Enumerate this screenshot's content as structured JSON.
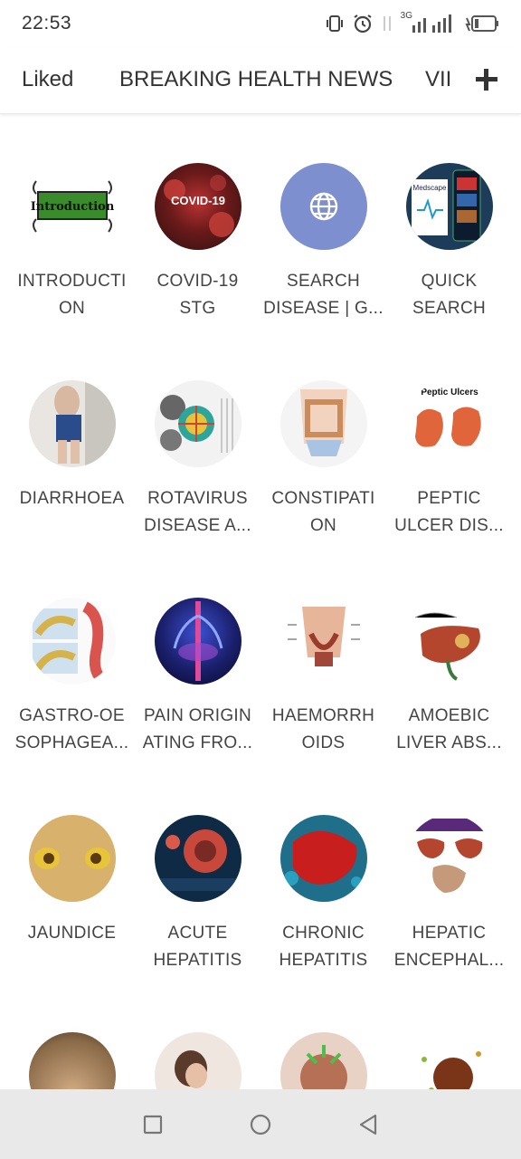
{
  "status": {
    "time": "22:53",
    "network": "3G"
  },
  "tabs": [
    {
      "label": "Liked"
    },
    {
      "label": "BREAKING HEALTH NEWS"
    },
    {
      "label": "VII"
    }
  ],
  "tiles": [
    {
      "label": "INTRODUCTI\nON",
      "image_text": "Introduction"
    },
    {
      "label": "COVID-19\nSTG",
      "image_text": "COVID-19"
    },
    {
      "label": "SEARCH\nDISEASE | G...",
      "icon": "globe-icon"
    },
    {
      "label": "QUICK\nSEARCH",
      "image_text": "Medscape"
    },
    {
      "label": "DIARRHOEA"
    },
    {
      "label": "ROTAVIRUS\nDISEASE A..."
    },
    {
      "label": "CONSTIPATI\nON"
    },
    {
      "label": "PEPTIC\nULCER DIS...",
      "image_text": "Peptic Ulcers"
    },
    {
      "label": "GASTRO-OE\nSOPHAGEA..."
    },
    {
      "label": "PAIN ORIGIN\nATING FRO..."
    },
    {
      "label": "HAEMORRH\nOIDS"
    },
    {
      "label": "AMOEBIC\nLIVER ABS..."
    },
    {
      "label": "JAUNDICE"
    },
    {
      "label": "ACUTE\nHEPATITIS"
    },
    {
      "label": "CHRONIC\nHEPATITIS"
    },
    {
      "label": "HEPATIC\nENCEPHAL..."
    },
    {
      "label": ""
    },
    {
      "label": ""
    },
    {
      "label": ""
    },
    {
      "label": ""
    }
  ],
  "colors": {
    "accent": "#7d8fcf",
    "nav_bg": "#e9e9e9"
  }
}
